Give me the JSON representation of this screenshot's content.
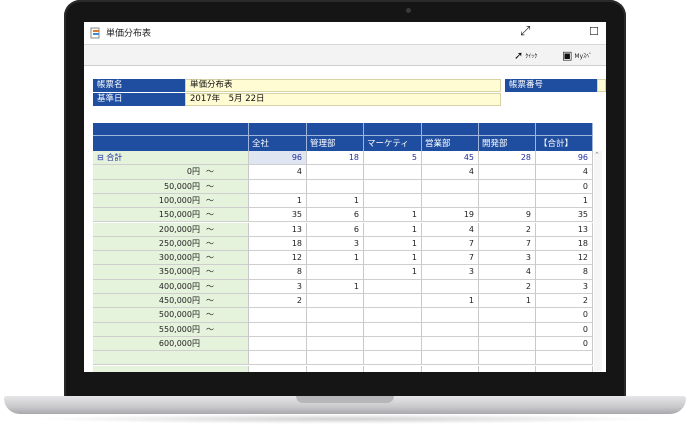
{
  "window": {
    "title": "単価分布表",
    "toolbar": [
      {
        "label": "ｸｲｯｸ",
        "icon": "quick-arrow-icon"
      },
      {
        "label": "Myｽﾍﾟ",
        "icon": "my-space-icon"
      }
    ]
  },
  "info": {
    "report_name_label": "帳票名",
    "report_name_value": "単価分布表",
    "report_number_label": "帳票番号",
    "report_number_value": "",
    "base_date_label": "基準日",
    "base_date_value": "2017年　5月 22日"
  },
  "table": {
    "columns": [
      "全社",
      "管理部",
      "マーケティ",
      "営業部",
      "開発部",
      "【合計】"
    ],
    "total_row": {
      "label": "合計",
      "values": [
        "96",
        "18",
        "5",
        "45",
        "28",
        "96"
      ]
    },
    "rows": [
      {
        "label": "0円",
        "values": [
          "4",
          "",
          "",
          "4",
          "",
          "4"
        ]
      },
      {
        "label": "50,000円",
        "values": [
          "",
          "",
          "",
          "",
          "",
          "0"
        ]
      },
      {
        "label": "100,000円",
        "values": [
          "1",
          "1",
          "",
          "",
          "",
          "1"
        ]
      },
      {
        "label": "150,000円",
        "values": [
          "35",
          "6",
          "1",
          "19",
          "9",
          "35"
        ]
      },
      {
        "label": "200,000円",
        "values": [
          "13",
          "6",
          "1",
          "4",
          "2",
          "13"
        ]
      },
      {
        "label": "250,000円",
        "values": [
          "18",
          "3",
          "1",
          "7",
          "7",
          "18"
        ]
      },
      {
        "label": "300,000円",
        "values": [
          "12",
          "1",
          "1",
          "7",
          "3",
          "12"
        ]
      },
      {
        "label": "350,000円",
        "values": [
          "8",
          "",
          "1",
          "3",
          "4",
          "8"
        ]
      },
      {
        "label": "400,000円",
        "values": [
          "3",
          "1",
          "",
          "",
          "2",
          "3"
        ]
      },
      {
        "label": "450,000円",
        "values": [
          "2",
          "",
          "",
          "1",
          "1",
          "2"
        ]
      },
      {
        "label": "500,000円",
        "values": [
          "",
          "",
          "",
          "",
          "",
          "0"
        ]
      },
      {
        "label": "550,000円",
        "values": [
          "",
          "",
          "",
          "",
          "",
          "0"
        ]
      },
      {
        "label": "600,000円",
        "values": [
          "",
          "",
          "",
          "",
          "",
          "0"
        ]
      }
    ],
    "range_suffix": "～",
    "collapse_symbol": "⊟"
  },
  "colors": {
    "header_blue": "#1f4ea1",
    "row_green": "#e6f3dc",
    "field_yellow": "#fffbd2"
  }
}
